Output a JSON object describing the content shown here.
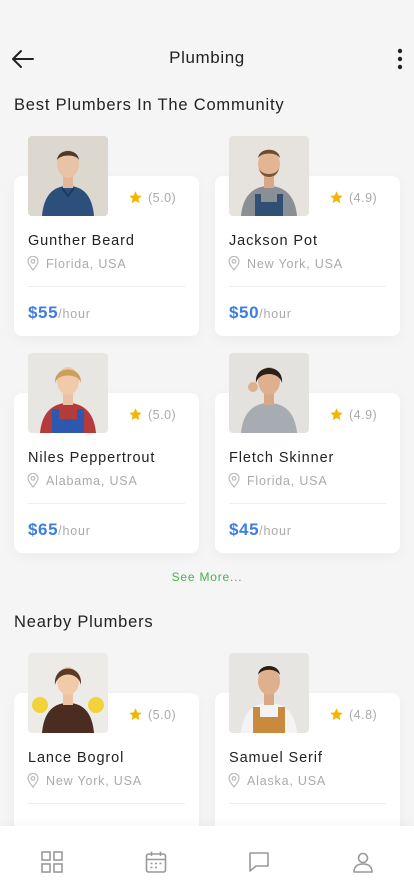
{
  "header": {
    "title": "Plumbing",
    "back_icon": "arrow-left-icon",
    "more_icon": "more-vertical-icon"
  },
  "sections": {
    "best_title": "Best Plumbers In The Community",
    "nearby_title": "Nearby Plumbers",
    "see_more": "See More..."
  },
  "best": [
    {
      "name": "Gunther Beard",
      "rating": "(5.0)",
      "location": "Florida, USA",
      "price": "$55",
      "unit": "/hour"
    },
    {
      "name": "Jackson Pot",
      "rating": "(4.9)",
      "location": "New York, USA",
      "price": "$50",
      "unit": "/hour"
    },
    {
      "name": "Niles Peppertrout",
      "rating": "(5.0)",
      "location": "Alabama, USA",
      "price": "$65",
      "unit": "/hour"
    },
    {
      "name": "Fletch Skinner",
      "rating": "(4.9)",
      "location": "Florida, USA",
      "price": "$45",
      "unit": "/hour"
    }
  ],
  "nearby": [
    {
      "name": "Lance Bogrol",
      "rating": "(5.0)",
      "location": "New York, USA"
    },
    {
      "name": "Samuel Serif",
      "rating": "(4.8)",
      "location": "Alaska, USA"
    }
  ],
  "nav": [
    {
      "icon": "grid-icon"
    },
    {
      "icon": "calendar-icon"
    },
    {
      "icon": "chat-icon"
    },
    {
      "icon": "profile-icon"
    }
  ],
  "colors": {
    "accent": "#3d7ee0",
    "star": "#f5b400",
    "link": "#4caf50",
    "background": "#f5f5f5"
  }
}
